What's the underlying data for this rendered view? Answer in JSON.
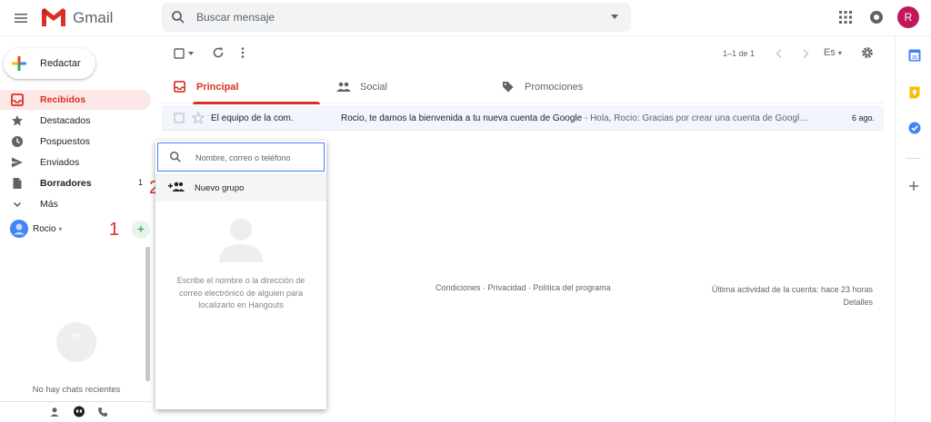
{
  "header": {
    "app_name": "Gmail",
    "search_placeholder": "Buscar mensaje",
    "avatar_letter": "R",
    "brand_red": "#d93025"
  },
  "sidebar": {
    "compose_label": "Redactar",
    "items": [
      {
        "label": "Recibidos",
        "icon": "inbox-icon",
        "active": true,
        "count": ""
      },
      {
        "label": "Destacados",
        "icon": "star-icon",
        "active": false,
        "count": ""
      },
      {
        "label": "Pospuestos",
        "icon": "clock-icon",
        "active": false,
        "count": ""
      },
      {
        "label": "Enviados",
        "icon": "send-icon",
        "active": false,
        "count": ""
      },
      {
        "label": "Borradores",
        "icon": "draft-icon",
        "active": false,
        "count": "1"
      },
      {
        "label": "Más",
        "icon": "chevron-down-icon",
        "active": false,
        "count": ""
      }
    ],
    "hangouts_user": "Rocio",
    "no_chats_text": "No hay chats recientes",
    "annotation_1": "1",
    "annotation_2": "2"
  },
  "toolbar": {
    "pager_text": "1–1 de 1",
    "language": "Es"
  },
  "tabs": [
    {
      "label": "Principal",
      "icon": "inbox-icon",
      "active": true
    },
    {
      "label": "Social",
      "icon": "people-icon",
      "active": false
    },
    {
      "label": "Promociones",
      "icon": "tag-icon",
      "active": false
    }
  ],
  "emails": [
    {
      "sender": "El equipo de la com.",
      "subject": "Rocio, te damos la bienvenida a tu nueva cuenta de Google",
      "snippet": " - Hola, Rocio: Gracias por crear una cuenta de Googl…",
      "date": "6 ago."
    }
  ],
  "footer": {
    "links": "Condiciones · Privacidad · Política del programa",
    "activity": "Última actividad de la cuenta: hace 23 horas",
    "details": "Detalles"
  },
  "hangouts_popup": {
    "search_placeholder": "Nombre, correo o teléfono",
    "new_group_label": "Nuevo grupo",
    "help_text": "Escribe el nombre o la dirección de correo electrónico de alguien para localizarlo en Hangouts"
  }
}
